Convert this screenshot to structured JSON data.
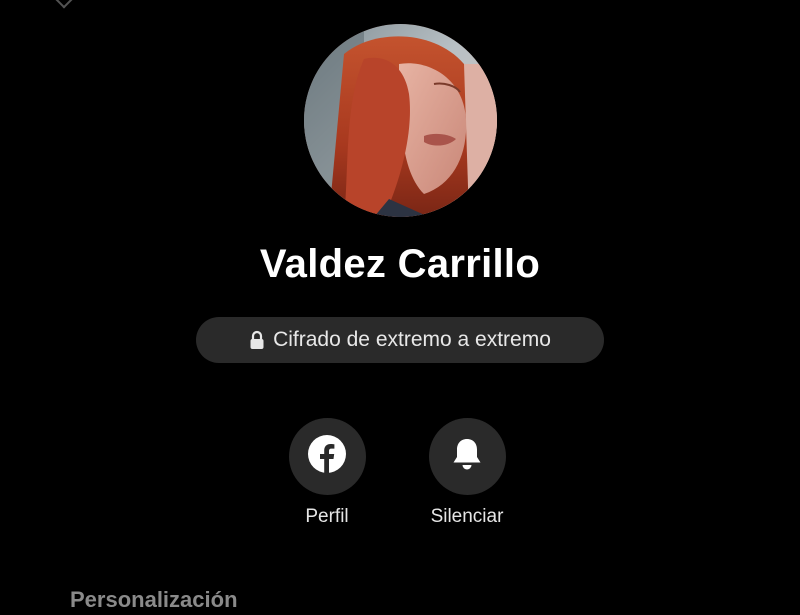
{
  "contact": {
    "name": "Valdez Carrillo",
    "avatar_icon": "profile-photo"
  },
  "encryption": {
    "label": "Cifrado de extremo a extremo",
    "icon": "lock-icon"
  },
  "actions": [
    {
      "label": "Perfil",
      "icon": "facebook-icon"
    },
    {
      "label": "Silenciar",
      "icon": "bell-icon"
    }
  ],
  "sections": {
    "personalization": "Personalización"
  },
  "colors": {
    "background": "#000000",
    "surface": "#2a2a2a",
    "text_primary": "#ffffff",
    "text_secondary": "#8a8a8a"
  }
}
